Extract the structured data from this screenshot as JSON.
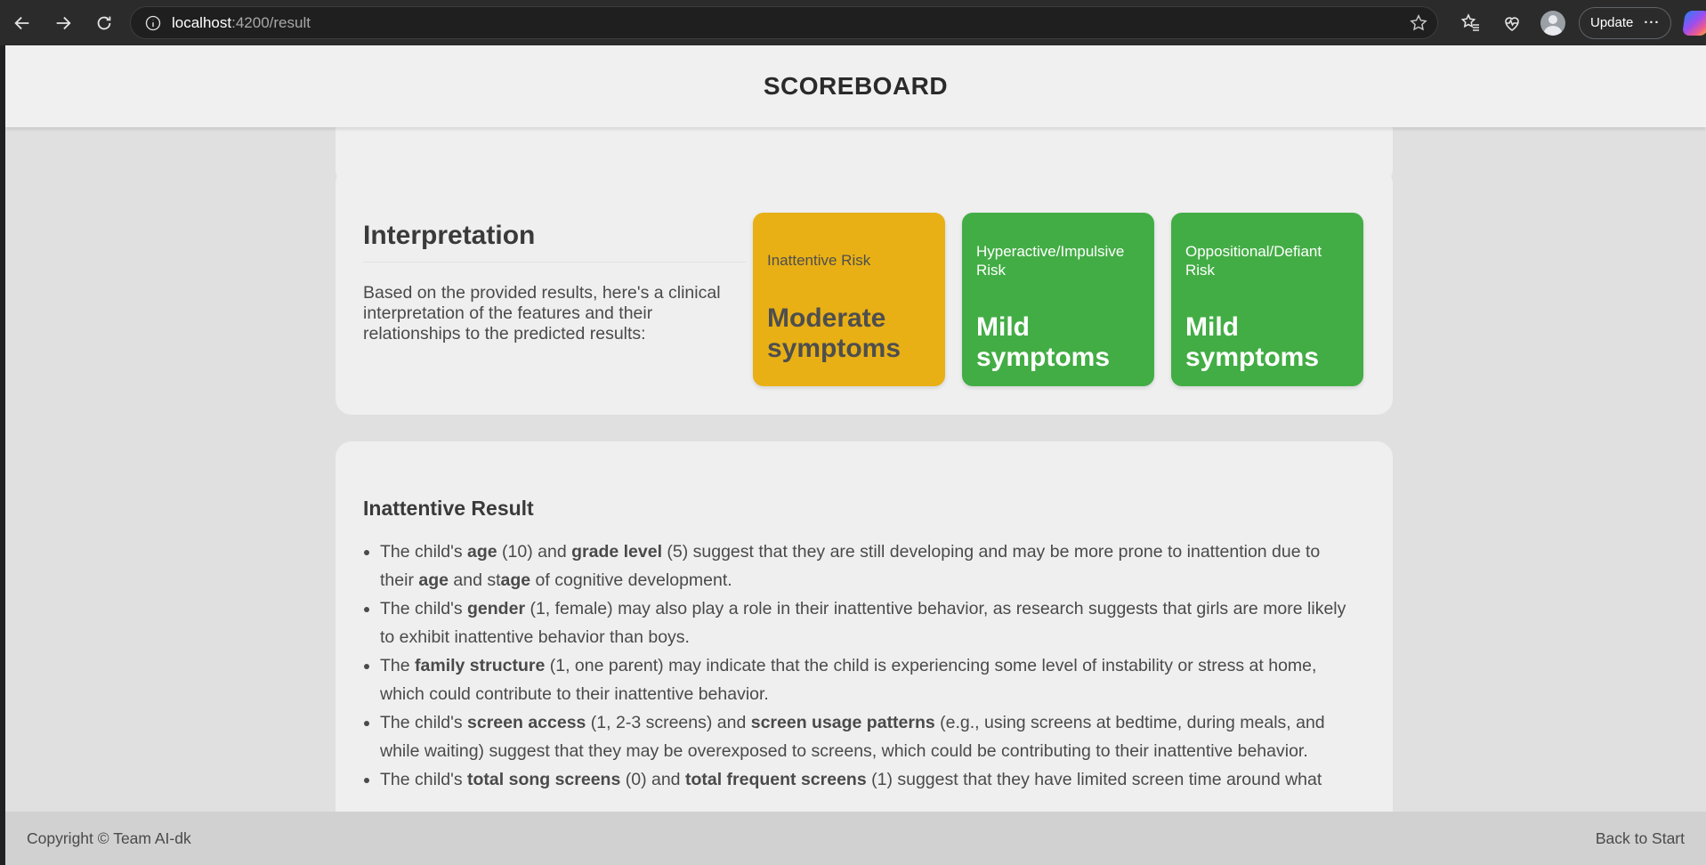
{
  "browser": {
    "url_host": "localhost",
    "url_path": ":4200/result",
    "update_label": "Update",
    "more_label": "···"
  },
  "header": {
    "title": "SCOREBOARD"
  },
  "interpretation": {
    "title": "Interpretation",
    "text": "Based on the provided results, here's a clinical interpretation of the features and their relationships to the predicted results:",
    "risks": [
      {
        "label": "Inattentive Risk",
        "value": "Moderate symptoms",
        "color": "#e8b015"
      },
      {
        "label": "Hyperactive/Impulsive Risk",
        "value": "Mild symptoms",
        "color": "#43ad45"
      },
      {
        "label": "Oppositional/Defiant Risk",
        "value": "Mild symptoms",
        "color": "#43ad45"
      }
    ]
  },
  "result": {
    "title": "Inattentive Result",
    "items": [
      [
        {
          "t": "The child's "
        },
        {
          "t": "age",
          "b": true
        },
        {
          "t": " (10) and "
        },
        {
          "t": "grade level",
          "b": true
        },
        {
          "t": " (5) suggest that they are still developing and may be more prone to inattention due to their "
        },
        {
          "t": "age",
          "b": true
        },
        {
          "t": " and st"
        },
        {
          "t": "age",
          "b": true
        },
        {
          "t": " of cognitive development."
        }
      ],
      [
        {
          "t": "The child's "
        },
        {
          "t": "gender",
          "b": true
        },
        {
          "t": " (1, female) may also play a role in their inattentive behavior, as research suggests that girls are more likely to exhibit inattentive behavior than boys."
        }
      ],
      [
        {
          "t": "The "
        },
        {
          "t": "family structure",
          "b": true
        },
        {
          "t": " (1, one parent) may indicate that the child is experiencing some level of instability or stress at home, which could contribute to their inattentive behavior."
        }
      ],
      [
        {
          "t": "The child's "
        },
        {
          "t": "screen access",
          "b": true
        },
        {
          "t": " (1, 2-3 screens) and "
        },
        {
          "t": "screen usage patterns",
          "b": true
        },
        {
          "t": " (e.g., using screens at bedtime, during meals, and while waiting) suggest that they may be overexposed to screens, which could be contributing to their inattentive behavior."
        }
      ],
      [
        {
          "t": "The child's "
        },
        {
          "t": "total song screens",
          "b": true
        },
        {
          "t": " (0) and "
        },
        {
          "t": "total frequent screens",
          "b": true
        },
        {
          "t": " (1) suggest that they have limited screen time around what"
        }
      ]
    ]
  },
  "footer": {
    "copyright": "Copyright © Team AI-dk",
    "back_link": "Back to Start"
  }
}
